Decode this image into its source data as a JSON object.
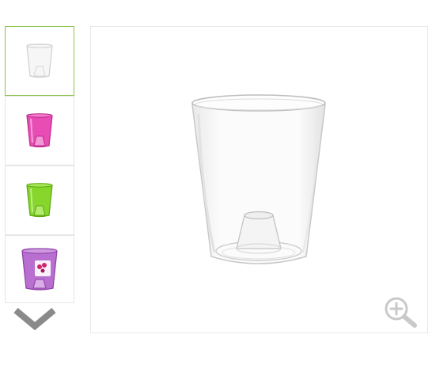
{
  "gallery": {
    "selected_index": 0,
    "thumbnails": [
      {
        "icon": "clear-pot-icon",
        "color": "#f2f2f2",
        "stroke": "#c8c8c8"
      },
      {
        "icon": "pink-pot-icon",
        "color": "#e83fb0",
        "stroke": "#c2288f"
      },
      {
        "icon": "green-pot-icon",
        "color": "#7ed321",
        "stroke": "#5ea812"
      },
      {
        "icon": "purple-pot-icon",
        "color": "#b163c8",
        "stroke": "#8d3fa6"
      }
    ],
    "scroll_icon": "chevron-down-icon",
    "main_image_icon": "clear-flower-pot-icon",
    "zoom_icon": "zoom-in-icon",
    "accent_color": "#8bc34a"
  }
}
